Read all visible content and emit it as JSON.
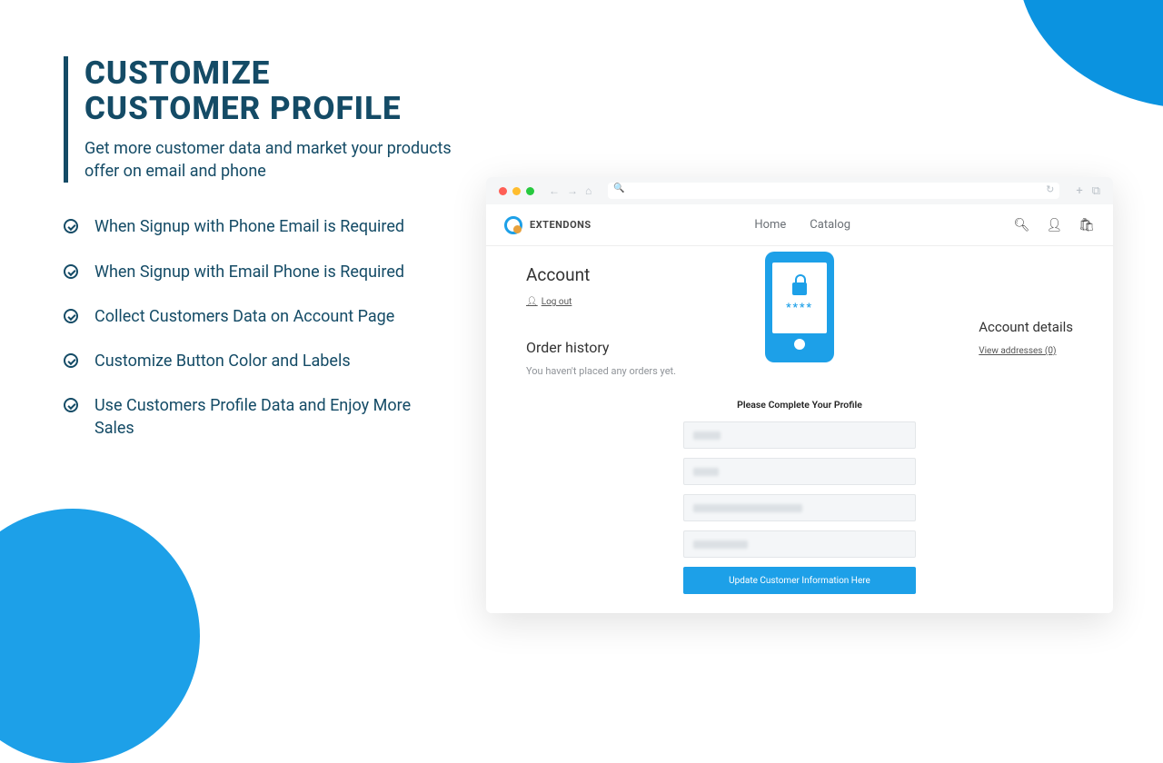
{
  "hero": {
    "title": "CUSTOMIZE CUSTOMER PROFILE",
    "subtitle": "Get more customer data and market your products offer on email and phone"
  },
  "bullets": [
    "When Signup with Phone Email is Required",
    "When Signup with Email Phone is Required",
    "Collect Customers Data on Account Page",
    "Customize Button Color and Labels",
    "Use Customers Profile Data and Enjoy More Sales"
  ],
  "store": {
    "brand": "EXTENDONS",
    "nav": {
      "home": "Home",
      "catalog": "Catalog"
    }
  },
  "account": {
    "heading": "Account",
    "logout": "Log out",
    "order_history_title": "Order history",
    "order_history_empty": "You haven't placed any orders yet.",
    "details_title": "Account details",
    "view_addresses": "View addresses (0)",
    "form_title": "Please Complete Your Profile",
    "submit_label": "Update Customer Information Here",
    "phone_stars": "****"
  }
}
